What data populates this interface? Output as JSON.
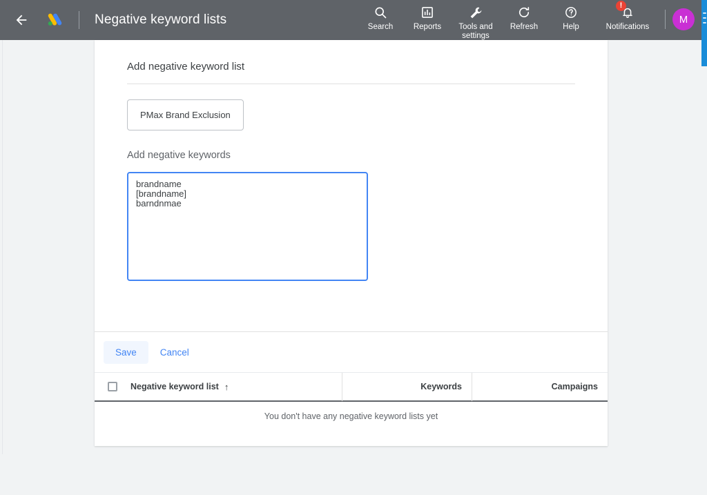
{
  "appbar": {
    "back_icon": "back-arrow-icon",
    "logo_icon": "google-ads-logo",
    "title": "Negative keyword lists",
    "tools": [
      {
        "icon": "search-icon",
        "label": "Search"
      },
      {
        "icon": "reports-icon",
        "label": "Reports"
      },
      {
        "icon": "wrench-icon",
        "label": "Tools and\nsettings"
      },
      {
        "icon": "refresh-icon",
        "label": "Refresh"
      },
      {
        "icon": "help-icon",
        "label": "Help"
      },
      {
        "icon": "bell-icon",
        "label": "Notifications",
        "badge": "!"
      }
    ],
    "avatar_initial": "M",
    "bg_color": "#5f6368",
    "avatar_color": "#c930d4",
    "badge_color": "#ea4335"
  },
  "panel": {
    "title": "Add negative keyword list",
    "list_name_chip": "PMax Brand Exclusion",
    "keywords_label": "Add negative keywords",
    "keywords_value": "brandname\n[brandname]\nbarndnmae",
    "keywords_placeholder": "",
    "save_label": "Save",
    "cancel_label": "Cancel",
    "accent_color": "#4285f4"
  },
  "table": {
    "columns": {
      "name": "Negative keyword list",
      "sort_arrow": "↑",
      "keywords": "Keywords",
      "campaigns": "Campaigns"
    },
    "empty_message": "You don't have any negative keyword lists yet"
  }
}
